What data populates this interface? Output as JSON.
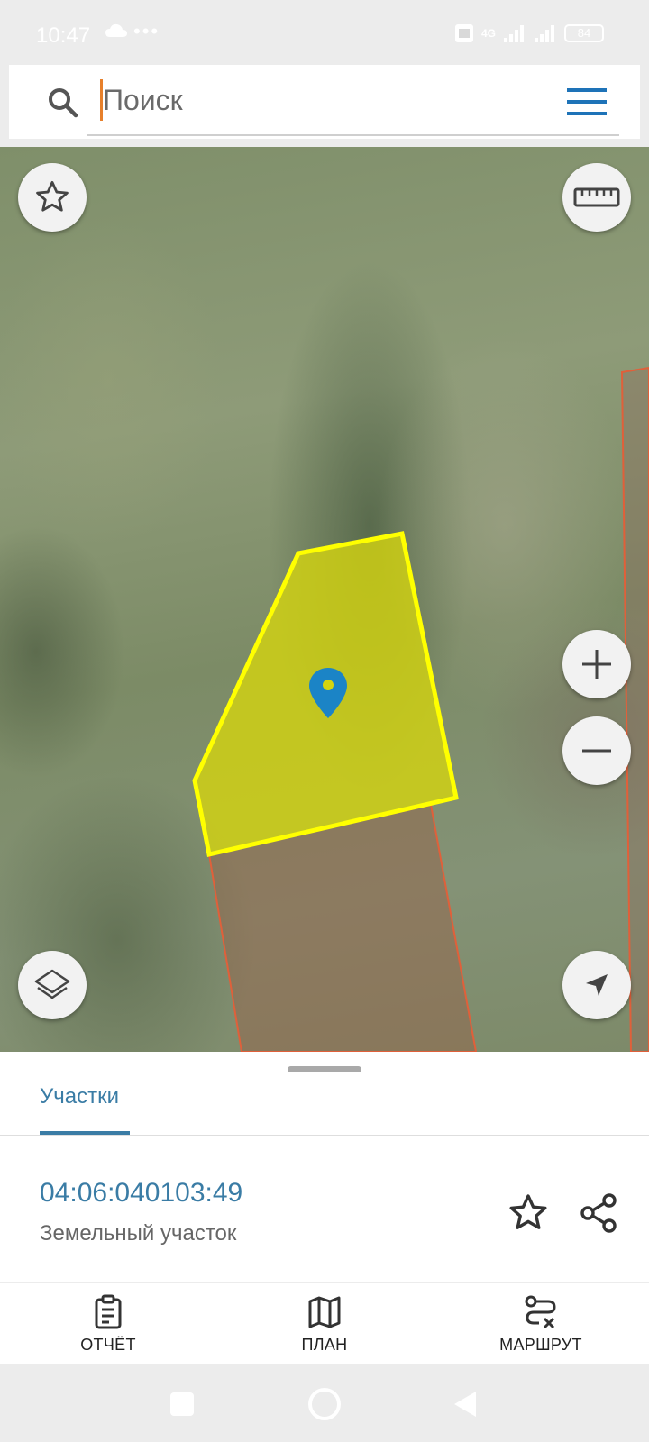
{
  "status_bar": {
    "time": "10:47",
    "dots": "•••",
    "network": "4G",
    "battery": "84"
  },
  "search": {
    "placeholder": "Поиск",
    "value": ""
  },
  "map": {
    "selected_parcel_fill": "#d4d40f",
    "selected_parcel_stroke": "#ffff00",
    "neighbor_parcel_stroke": "#e0603a",
    "marker_color": "#1b84c6"
  },
  "sheet": {
    "tab_label": "Участки",
    "parcel_id": "04:06:040103:49",
    "parcel_type": "Земельный участок"
  },
  "actions": [
    {
      "label": "ОТЧЁТ",
      "icon": "report-icon"
    },
    {
      "label": "ПЛАН",
      "icon": "map-plan-icon"
    },
    {
      "label": "МАРШРУТ",
      "icon": "route-icon"
    }
  ],
  "colors": {
    "accent": "#3a7ca5",
    "caret": "#e7802b",
    "menu": "#1e73b8"
  }
}
